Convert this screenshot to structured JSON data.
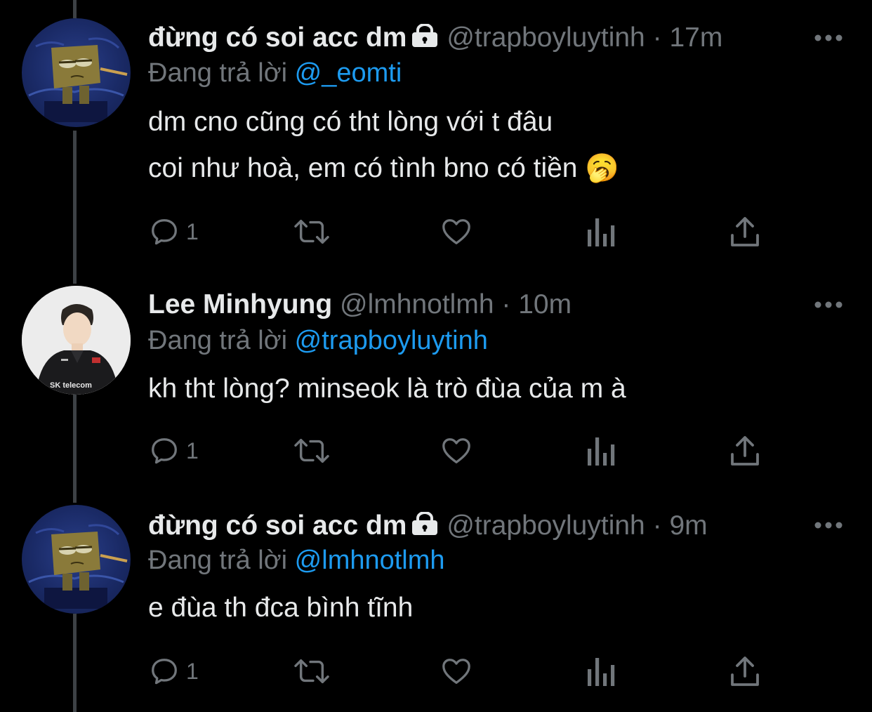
{
  "tweets": [
    {
      "avatar_icon": "spongebob-avatar-icon",
      "name": "đừng có soi acc dm",
      "locked": true,
      "handle": "@trapboyluytinh",
      "separator": "·",
      "time": "17m",
      "reply_prefix": "Đang trả lời",
      "reply_to": "@_eomti",
      "lines": [
        "dm cno cũng có tht lòng với t đâu",
        "coi như hoà, em có tình bno có tiền 🥱"
      ],
      "reply_count": "1"
    },
    {
      "avatar_icon": "person-avatar-icon",
      "name": "Lee Minhyung",
      "locked": false,
      "handle": "@lmhnotlmh",
      "separator": "·",
      "time": "10m",
      "reply_prefix": "Đang trả lời",
      "reply_to": "@trapboyluytinh",
      "lines": [
        "kh tht lòng? minseok là trò đùa của m à"
      ],
      "reply_count": "1"
    },
    {
      "avatar_icon": "spongebob-avatar-icon",
      "name": "đừng có soi acc dm",
      "locked": true,
      "handle": "@trapboyluytinh",
      "separator": "·",
      "time": "9m",
      "reply_prefix": "Đang trả lời",
      "reply_to": "@lmhnotlmh",
      "lines": [
        "e đùa th đca bình tĩnh"
      ],
      "reply_count": "1"
    }
  ],
  "avatar_text": {
    "sk_logo": "SK telecom"
  },
  "colors": {
    "background": "#000000",
    "text": "#e7e9ea",
    "secondary": "#71767b",
    "link": "#1d9bf0",
    "thread_line": "#3d4145"
  }
}
